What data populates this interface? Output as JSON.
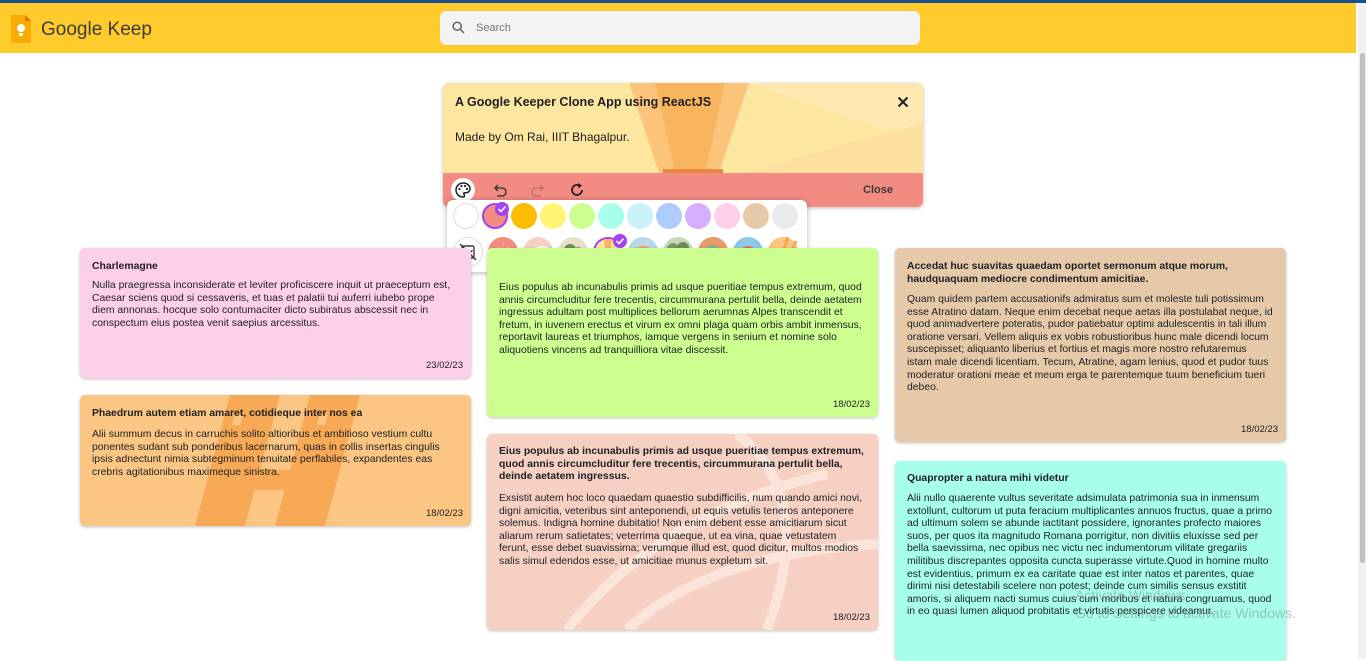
{
  "app": {
    "title": "Google Keep",
    "search_placeholder": "Search"
  },
  "editor": {
    "title": "A Google Keeper Clone App using ReactJS",
    "body": "Made by Om Rai, IIIT Bhagalpur.",
    "close_label": "Close",
    "background_color": "#fde7a0",
    "toolbar_color": "#f28b82"
  },
  "palette": {
    "colors": [
      "#ffffff",
      "#f28b82",
      "#fbbc04",
      "#fff475",
      "#ccff90",
      "#a7ffeb",
      "#cbf0f8",
      "#aecbfa",
      "#d7aefb",
      "#fdcfe8",
      "#e6c9a8",
      "#e8eaed"
    ],
    "selected_color_index": 1,
    "backgrounds": [
      "no-background-icon",
      "groceries-bg",
      "food-bg",
      "music-bg",
      "recipes-bg",
      "notes-bg",
      "places-bg",
      "travel-bg",
      "video-bg",
      "celebration-bg"
    ],
    "selected_background_index": 4
  },
  "notes": [
    {
      "title": "Charlemagne",
      "body": "Nulla praegressa inconsiderate et leviter proficiscere inquit ut praeceptum est, Caesar sciens quod si cessaveris, et tuas et palatii tui auferri iubebo prope diem annonas. hocque solo contumaciter dicto subiratus abscessit nec in conspectum eius postea venit saepius arcessitus.",
      "date": "23/02/23",
      "color": "#fdcfe8"
    },
    {
      "title": "Phaedrum autem etiam amaret, cotidieque inter nos ea",
      "body": "Alii summum decus in carruchis solito altioribus et ambitioso vestium cultu ponentes sudant sub ponderibus lacernarum, quas in collis insertas cingulis ipsis adnectunt nimia subtegminum tenuitate perflabiles, expandentes eas crebris agitationibus maximeque sinistra.",
      "date": "18/02/23",
      "color": "#fbc683"
    },
    {
      "title": "",
      "body": "Eius populus ab incunabulis primis ad usque pueritiae tempus extremum, quod annis circumcluditur fere trecentis, circummurana pertulit bella, deinde aetatem ingressus adultam post multiplices bellorum aerumnas Alpes transcendit et fretum, in iuvenem erectus et virum ex omni plaga quam orbis ambit inmensus, reportavit laureas et triumphos, iamque vergens in senium et nomine solo aliquotiens vincens ad tranquilliora vitae discessit.",
      "date": "18/02/23",
      "color": "#ccff90"
    },
    {
      "title": "Eius populus ab incunabulis primis ad usque pueritiae tempus extremum, quod annis circumcluditur fere trecentis, circummurana pertulit bella, deinde aetatem ingressus.",
      "body": "Exsistit autem hoc loco quaedam quaestio subdifficilis, num quando amici novi, digni amicitia, veteribus sint anteponendi, ut equis vetulis teneros anteponere solemus. Indigna homine dubitatio! Non enim debent esse amicitiarum sicut aliarum rerum satietates; veterrima quaeque, ut ea vina, quae vetustatem ferunt, esse debet suavissima; verumque illud est, quod dicitur, multos modios salis simul edendos esse, ut amicitiae munus expletum sit.",
      "date": "18/02/23",
      "color": "#f6d0c2"
    },
    {
      "title": "Accedat huc suavitas quaedam oportet sermonum atque morum, haudquaquam mediocre condimentum amicitiae.",
      "body": "Quam quidem partem accusationifs admiratus sum et moleste tuli potissimum esse Atratino datam. Neque enim decebat neque aetas illa postulabat neque, id quod animadvertere poteratis, pudor patiebatur optimi adulescentis in tali illum oratione versari. Vellem aliquis ex vobis robustioribus hunc male dicendi locum suscepisset; aliquanto liberius et fortius et magis more nostro refutaremus istam male dicendi licentiam. Tecum, Atratine, agam lenius, quod et pudor tuus moderatur orationi meae et meum erga te parentemque tuum beneficium tueri debeo.",
      "date": "18/02/23",
      "color": "#e6c9a8"
    },
    {
      "title": "Quapropter a natura mihi videtur",
      "body": "Alii nullo quaerente vultus severitate adsimulata patrimonia sua in inmensum extollunt, cultorum ut puta feracium multiplicantes annuos fructus, quae a primo ad ultimum solem se abunde iactitant possidere, ignorantes profecto maiores suos, per quos ita magnitudo Romana porrigitur, non divitiis eluxisse sed per bella saevissima, nec opibus nec victu nec indumentorum vilitate gregariis militibus discrepantes opposita cuncta superasse virtute.Quod in homine multo est evidentius, primum ex ea caritate quae est inter natos et parentes, quae dirimi nisi detestabili scelere non potest; deinde cum similis sensus exstitit amoris, si aliquem nacti sumus cuius cum moribus et natura congruamus, quod in eo quasi lumen aliquod probitatis et virtutis perspicere videamur.",
      "date": "",
      "color": "#a7ffeb"
    }
  ],
  "watermark": {
    "line1": "Activate Windows",
    "line2": "Go to Settings to activate Windows."
  }
}
